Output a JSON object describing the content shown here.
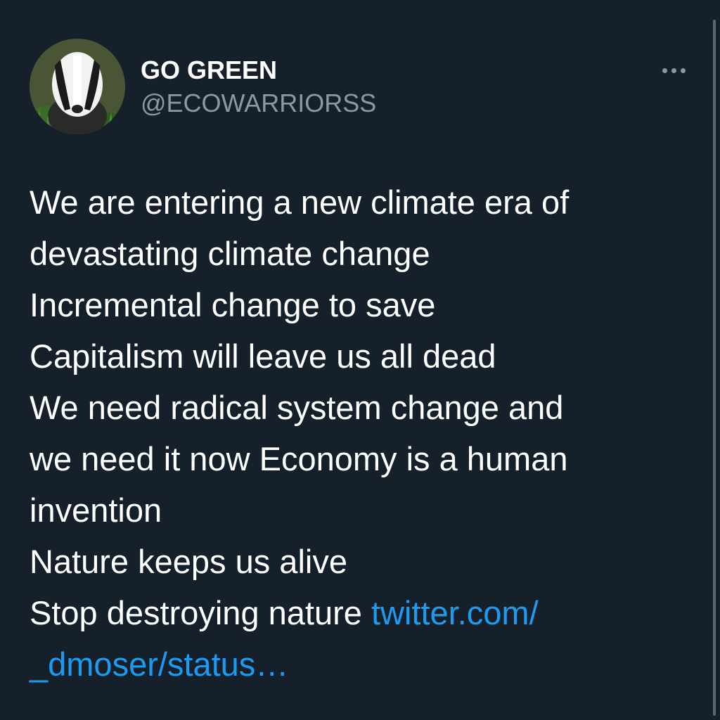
{
  "tweet": {
    "display_name": "GO GREEN",
    "handle": "@ECOWARRIORSS",
    "more_icon": "more-horizontal-icon",
    "avatar_icon": "badger-avatar",
    "lines": [
      "We are entering a new climate era of",
      "devastating climate change",
      "Incremental change to save",
      "Capitalism will leave us all dead",
      "We need radical system change and",
      "we need it now Economy is a human",
      "invention",
      "Nature keeps us alive",
      "Stop destroying nature "
    ],
    "link_part1": "twitter.com/",
    "link_part2": "_dmoser/status…"
  },
  "colors": {
    "background": "#15202b",
    "text": "#ffffff",
    "secondary_text": "#8b98a5",
    "link": "#1d9bf0"
  }
}
